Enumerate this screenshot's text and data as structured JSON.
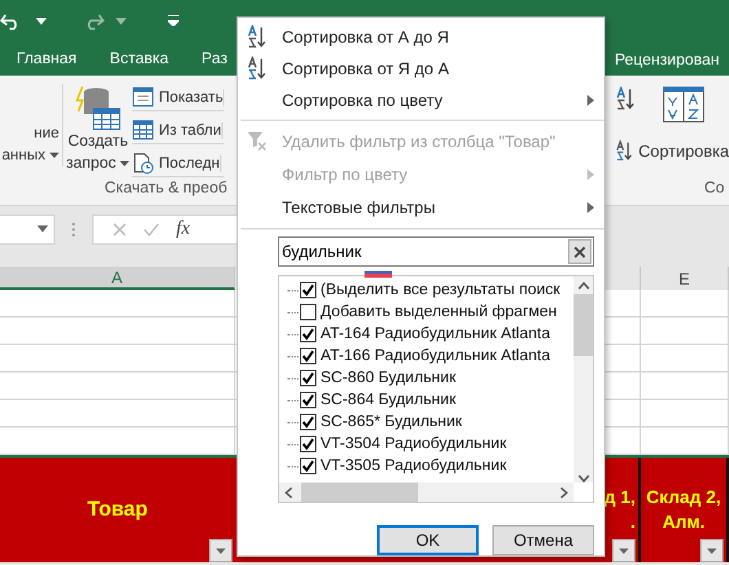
{
  "ribbon_tabs": [
    {
      "label": "Главная",
      "selected": false
    },
    {
      "label": "Вставка",
      "selected": false
    },
    {
      "label": "Раз",
      "selected": false
    },
    {
      "label": "Рецензирован",
      "selected": false
    }
  ],
  "ribbon": {
    "partial_button": [
      "ние",
      "анных"
    ],
    "query_button": [
      "Создать",
      "запрос"
    ],
    "small_buttons": [
      "Показать",
      "Из табли",
      "Последн"
    ],
    "group_label": "Скачать & преоб",
    "sort_button": "Сортировка",
    "sort_group_label": "Со"
  },
  "formula_bar": {
    "function_label": "fx"
  },
  "sheet": {
    "columns": [
      {
        "label": "A"
      },
      {
        "label": "E"
      }
    ],
    "header_cells": [
      {
        "lines": [
          "Товар"
        ]
      },
      {
        "lines": [
          "д 1,",
          "."
        ]
      },
      {
        "lines": [
          "Склад 2,",
          "Алм."
        ]
      }
    ]
  },
  "filter_menu": {
    "items": [
      {
        "label": "Сортировка от А до Я",
        "kind": "sort_asc",
        "disabled": false,
        "submenu": false,
        "separator_before": false
      },
      {
        "label": "Сортировка от Я до А",
        "kind": "sort_desc",
        "disabled": false,
        "submenu": false,
        "separator_before": false
      },
      {
        "label": "Сортировка по цвету",
        "kind": "plain",
        "disabled": false,
        "submenu": true,
        "separator_before": false
      },
      {
        "label": "Удалить фильтр из столбца \"Товар\"",
        "kind": "clear_filter",
        "disabled": true,
        "submenu": false,
        "separator_before": true
      },
      {
        "label": "Фильтр по цвету",
        "kind": "plain",
        "disabled": true,
        "submenu": true,
        "separator_before": false
      },
      {
        "label": "Текстовые фильтры",
        "kind": "plain",
        "disabled": false,
        "submenu": true,
        "separator_before": false
      }
    ],
    "search": {
      "value": "будильник"
    },
    "values": [
      {
        "label": "(Выделить все результаты поиск",
        "checked": true
      },
      {
        "label": "Добавить выделенный фрагмен",
        "checked": false
      },
      {
        "label": "AT-164  Радиобудильник Atlanta",
        "checked": true
      },
      {
        "label": "AT-166  Радиобудильник Atlanta",
        "checked": true
      },
      {
        "label": "SC-860 Будильник",
        "checked": true
      },
      {
        "label": "SC-864 Будильник",
        "checked": true
      },
      {
        "label": "SC-865* Будильник",
        "checked": true
      },
      {
        "label": "VT-3504 Радиобудильник",
        "checked": true
      },
      {
        "label": "VT-3505 Радиобудильник",
        "checked": true
      }
    ],
    "buttons": [
      {
        "label": "OK",
        "default": true
      },
      {
        "label": "Отмена",
        "default": false
      }
    ]
  }
}
